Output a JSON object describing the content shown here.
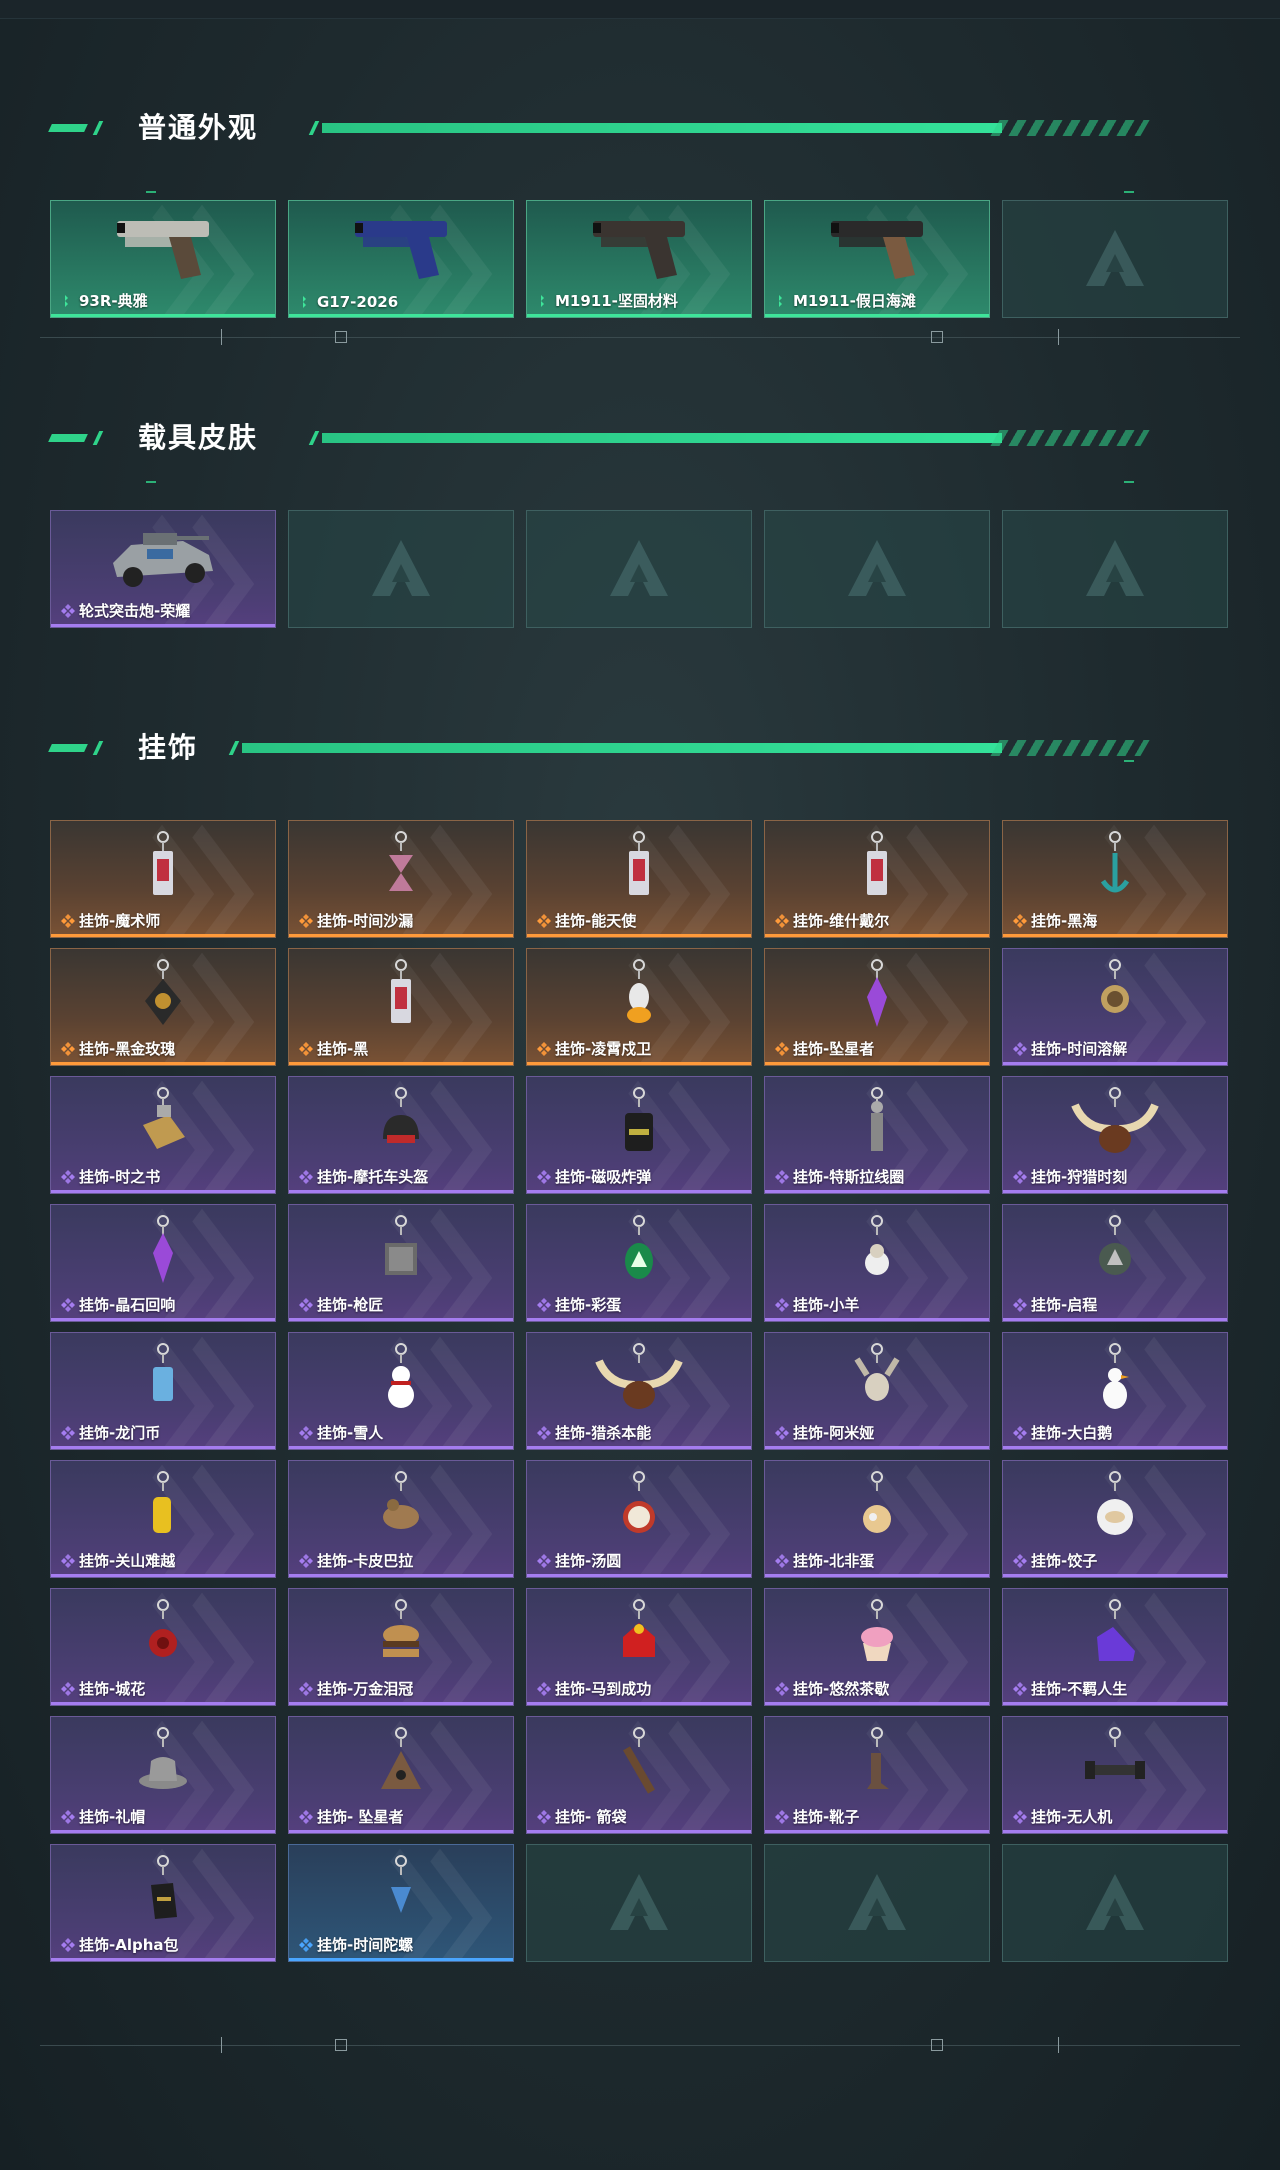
{
  "sections": [
    {
      "title": "普通外观",
      "items": [
        {
          "label": "93R-典雅",
          "rarity": "green",
          "icon": "pistol-silver-icon"
        },
        {
          "label": "G17-2026",
          "rarity": "green",
          "icon": "pistol-blue-icon"
        },
        {
          "label": "M1911-坚固材料",
          "rarity": "green",
          "icon": "pistol-dark-icon"
        },
        {
          "label": "M1911-假日海滩",
          "rarity": "green",
          "icon": "pistol-black-icon"
        },
        {
          "label": "",
          "rarity": "empty",
          "icon": "placeholder-logo-icon"
        }
      ]
    },
    {
      "title": "载具皮肤",
      "items": [
        {
          "label": "轮式突击炮-荣耀",
          "rarity": "purple",
          "icon": "vehicle-icon"
        },
        {
          "label": "",
          "rarity": "empty",
          "icon": "placeholder-logo-icon"
        },
        {
          "label": "",
          "rarity": "empty",
          "icon": "placeholder-logo-icon"
        },
        {
          "label": "",
          "rarity": "empty",
          "icon": "placeholder-logo-icon"
        },
        {
          "label": "",
          "rarity": "empty",
          "icon": "placeholder-logo-icon"
        }
      ]
    },
    {
      "title": "挂饰",
      "items": [
        {
          "label": "挂饰-魔术师",
          "rarity": "orange",
          "icon": "charm-card-icon"
        },
        {
          "label": "挂饰-时间沙漏",
          "rarity": "orange",
          "icon": "charm-hourglass-icon"
        },
        {
          "label": "挂饰-能天使",
          "rarity": "orange",
          "icon": "charm-card-icon"
        },
        {
          "label": "挂饰-维什戴尔",
          "rarity": "orange",
          "icon": "charm-card-icon"
        },
        {
          "label": "挂饰-黑海",
          "rarity": "orange",
          "icon": "charm-anchor-icon"
        },
        {
          "label": "挂饰-黑金玫瑰",
          "rarity": "orange",
          "icon": "charm-rose-icon"
        },
        {
          "label": "挂饰-黑",
          "rarity": "orange",
          "icon": "charm-card-icon"
        },
        {
          "label": "挂饰-凌霄戍卫",
          "rarity": "orange",
          "icon": "charm-bird-icon"
        },
        {
          "label": "挂饰-坠星者",
          "rarity": "orange",
          "icon": "charm-crystal-icon"
        },
        {
          "label": "挂饰-时间溶解",
          "rarity": "purple",
          "icon": "charm-clock-icon"
        },
        {
          "label": "挂饰-时之书",
          "rarity": "purple",
          "icon": "charm-book-icon"
        },
        {
          "label": "挂饰-摩托车头盔",
          "rarity": "purple",
          "icon": "charm-helmet-icon"
        },
        {
          "label": "挂饰-磁吸炸弹",
          "rarity": "purple",
          "icon": "charm-bomb-icon"
        },
        {
          "label": "挂饰-特斯拉线圈",
          "rarity": "purple",
          "icon": "charm-coil-icon"
        },
        {
          "label": "挂饰-狩猎时刻",
          "rarity": "purple",
          "icon": "charm-antlers-icon"
        },
        {
          "label": "挂饰-晶石回响",
          "rarity": "purple",
          "icon": "charm-crystal-icon"
        },
        {
          "label": "挂饰-枪匠",
          "rarity": "purple",
          "icon": "charm-box-icon"
        },
        {
          "label": "挂饰-彩蛋",
          "rarity": "purple",
          "icon": "charm-egg-icon"
        },
        {
          "label": "挂饰-小羊",
          "rarity": "purple",
          "icon": "charm-sheep-icon"
        },
        {
          "label": "挂饰-启程",
          "rarity": "purple",
          "icon": "charm-medal-icon"
        },
        {
          "label": "挂饰-龙门币",
          "rarity": "purple",
          "icon": "charm-coin-icon"
        },
        {
          "label": "挂饰-雪人",
          "rarity": "purple",
          "icon": "charm-snowman-icon"
        },
        {
          "label": "挂饰-猎杀本能",
          "rarity": "purple",
          "icon": "charm-antlers-icon"
        },
        {
          "label": "挂饰-阿米娅",
          "rarity": "purple",
          "icon": "charm-bunny-icon"
        },
        {
          "label": "挂饰-大白鹅",
          "rarity": "purple",
          "icon": "charm-goose-icon"
        },
        {
          "label": "挂饰-关山难越",
          "rarity": "purple",
          "icon": "charm-scroll-icon"
        },
        {
          "label": "挂饰-卡皮巴拉",
          "rarity": "purple",
          "icon": "charm-capybara-icon"
        },
        {
          "label": "挂饰-汤圆",
          "rarity": "purple",
          "icon": "charm-bowl-icon"
        },
        {
          "label": "挂饰-北非蛋",
          "rarity": "purple",
          "icon": "charm-pan-icon"
        },
        {
          "label": "挂饰-饺子",
          "rarity": "purple",
          "icon": "charm-plate-icon"
        },
        {
          "label": "挂饰-城花",
          "rarity": "purple",
          "icon": "charm-flower-icon"
        },
        {
          "label": "挂饰-万金泪冠",
          "rarity": "purple",
          "icon": "charm-burger-icon"
        },
        {
          "label": "挂饰-马到成功",
          "rarity": "purple",
          "icon": "charm-horse-icon"
        },
        {
          "label": "挂饰-悠然茶歇",
          "rarity": "purple",
          "icon": "charm-cupcake-icon"
        },
        {
          "label": "挂饰-不羁人生",
          "rarity": "purple",
          "icon": "charm-shoe-icon"
        },
        {
          "label": "挂饰-礼帽",
          "rarity": "purple",
          "icon": "charm-hat-icon"
        },
        {
          "label": "挂饰- 坠星者",
          "rarity": "purple",
          "icon": "charm-pyramid-icon"
        },
        {
          "label": "挂饰- 箭袋",
          "rarity": "purple",
          "icon": "charm-quiver-icon"
        },
        {
          "label": "挂饰-靴子",
          "rarity": "purple",
          "icon": "charm-boot-icon"
        },
        {
          "label": "挂饰-无人机",
          "rarity": "purple",
          "icon": "charm-drone-icon"
        },
        {
          "label": "挂饰-Alpha包",
          "rarity": "purple",
          "icon": "charm-bag-icon"
        },
        {
          "label": "挂饰-时间陀螺",
          "rarity": "blue",
          "icon": "charm-top-icon"
        },
        {
          "label": "",
          "rarity": "empty",
          "icon": "placeholder-logo-icon"
        },
        {
          "label": "",
          "rarity": "empty",
          "icon": "placeholder-logo-icon"
        },
        {
          "label": "",
          "rarity": "empty",
          "icon": "placeholder-logo-icon"
        }
      ]
    }
  ],
  "colors": {
    "accent": "#2fd38a",
    "green_rarity": "#3ee59a",
    "orange_rarity": "#ff9a3a",
    "purple_rarity": "#a57df0",
    "blue_rarity": "#4aa6ff"
  }
}
